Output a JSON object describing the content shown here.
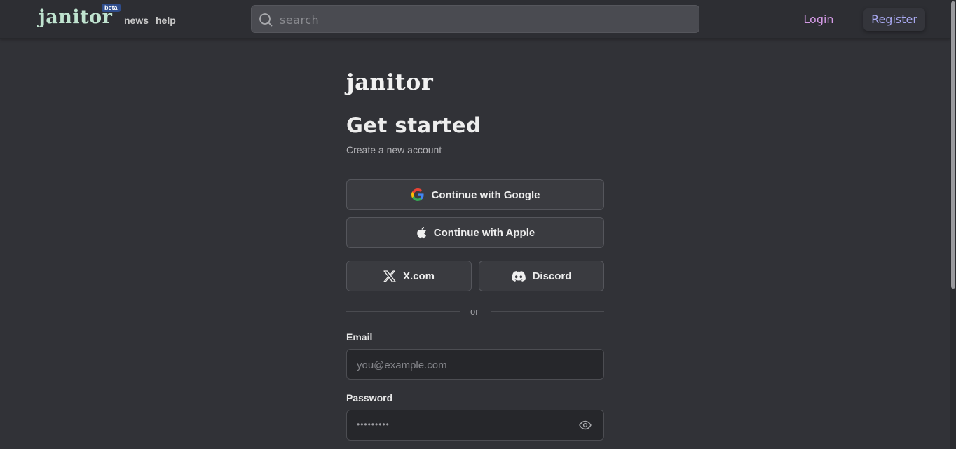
{
  "header": {
    "brand": "janitor",
    "beta_badge": "beta",
    "nav": {
      "news": "news",
      "help": "help"
    },
    "search": {
      "placeholder": "search"
    },
    "login_label": "Login",
    "register_label": "Register"
  },
  "main": {
    "logo": "janitor",
    "title": "Get started",
    "subtitle": "Create a new account",
    "buttons": {
      "google": "Continue with Google",
      "apple": "Continue with Apple",
      "x": "X.com",
      "discord": "Discord"
    },
    "divider_text": "or",
    "email": {
      "label": "Email",
      "placeholder": "you@example.com"
    },
    "password": {
      "label": "Password",
      "masked_value": "•••••••••"
    }
  },
  "colors": {
    "background": "#313237",
    "topbar": "#2d2e33",
    "brand": "#bfe3cf",
    "login": "#d49ae6",
    "register": "#a8a8f0"
  },
  "icons": [
    "search-icon",
    "google-icon",
    "apple-icon",
    "x-icon",
    "discord-icon",
    "eye-icon"
  ]
}
